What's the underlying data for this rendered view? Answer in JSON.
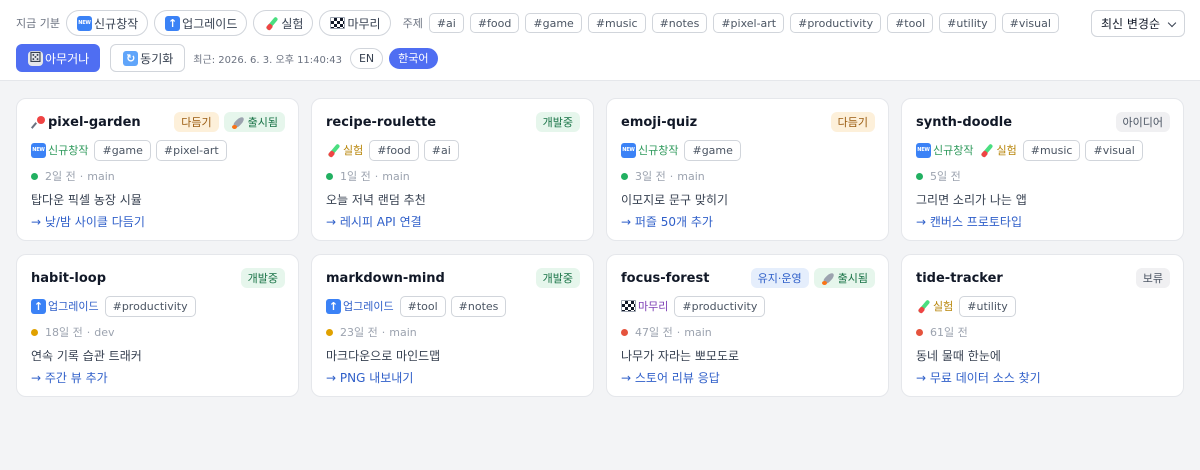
{
  "filter": {
    "current_label": "지금 기분",
    "moods": [
      {
        "icon": "new-icon",
        "label": "신규창작"
      },
      {
        "icon": "up-arrow-icon",
        "label": "업그레이드"
      },
      {
        "icon": "test-tube-icon",
        "label": "실험"
      },
      {
        "icon": "checkered-flag-icon",
        "label": "마무리"
      }
    ],
    "topic_label": "주제",
    "topics": [
      "#ai",
      "#food",
      "#game",
      "#music",
      "#notes",
      "#pixel-art",
      "#productivity",
      "#tool",
      "#utility",
      "#visual"
    ],
    "sort_value": "최신 변경순"
  },
  "actions": {
    "random_label": "아무거나",
    "sync_label": "동기화",
    "recent_text": "최근: 2026. 6. 3. 오후 11:40:43",
    "lang_en": "EN",
    "lang_ko": "한국어"
  },
  "projects": [
    {
      "name": "pixel-garden",
      "pinned": true,
      "badges": [
        {
          "kind": "polish",
          "label": "다듬기"
        },
        {
          "kind": "shipped",
          "label": "출시됨"
        }
      ],
      "category": {
        "kind": "new",
        "label": "신규창작"
      },
      "tags": [
        "#game",
        "#pixel-art"
      ],
      "status": "green",
      "age": "2일 전",
      "branch": "main",
      "description": "탑다운 픽셀 농장 시뮬",
      "next": "→ 낮/밤 사이클 다듬기"
    },
    {
      "name": "recipe-roulette",
      "pinned": false,
      "badges": [
        {
          "kind": "dev",
          "label": "개발중"
        }
      ],
      "category": {
        "kind": "test",
        "label": "실험"
      },
      "tags": [
        "#food",
        "#ai"
      ],
      "status": "green",
      "age": "1일 전",
      "branch": "main",
      "description": "오늘 저녁 랜덤 추천",
      "next": "→ 레시피 API 연결"
    },
    {
      "name": "emoji-quiz",
      "pinned": false,
      "badges": [
        {
          "kind": "polish",
          "label": "다듬기"
        }
      ],
      "category": {
        "kind": "new",
        "label": "신규창작"
      },
      "tags": [
        "#game"
      ],
      "status": "green",
      "age": "3일 전",
      "branch": "main",
      "description": "이모지로 문구 맞히기",
      "next": "→ 퍼즐 50개 추가"
    },
    {
      "name": "synth-doodle",
      "pinned": false,
      "badges": [
        {
          "kind": "idea",
          "label": "아이디어"
        }
      ],
      "category": {
        "kind": "new",
        "label": "신규창작"
      },
      "category2": {
        "kind": "test",
        "label": "실험"
      },
      "tags": [
        "#music",
        "#visual"
      ],
      "status": "green",
      "age": "5일 전",
      "branch": "",
      "description": "그리면 소리가 나는 앱",
      "next": "→ 캔버스 프로토타입"
    },
    {
      "name": "habit-loop",
      "pinned": false,
      "badges": [
        {
          "kind": "dev",
          "label": "개발중"
        }
      ],
      "category": {
        "kind": "up",
        "label": "업그레이드"
      },
      "tags": [
        "#productivity"
      ],
      "status": "yellow",
      "age": "18일 전",
      "branch": "dev",
      "description": "연속 기록 습관 트래커",
      "next": "→ 주간 뷰 추가"
    },
    {
      "name": "markdown-mind",
      "pinned": false,
      "badges": [
        {
          "kind": "dev",
          "label": "개발중"
        }
      ],
      "category": {
        "kind": "up",
        "label": "업그레이드"
      },
      "tags": [
        "#tool",
        "#notes"
      ],
      "status": "yellow",
      "age": "23일 전",
      "branch": "main",
      "description": "마크다운으로 마인드맵",
      "next": "→ PNG 내보내기"
    },
    {
      "name": "focus-forest",
      "pinned": false,
      "badges": [
        {
          "kind": "maint",
          "label": "유지·운영"
        },
        {
          "kind": "shipped",
          "label": "출시됨"
        }
      ],
      "category": {
        "kind": "flag",
        "label": "마무리"
      },
      "tags": [
        "#productivity"
      ],
      "status": "red",
      "age": "47일 전",
      "branch": "main",
      "description": "나무가 자라는 뽀모도로",
      "next": "→ 스토어 리뷰 응답"
    },
    {
      "name": "tide-tracker",
      "pinned": false,
      "badges": [
        {
          "kind": "hold",
          "label": "보류"
        }
      ],
      "category": {
        "kind": "test",
        "label": "실험"
      },
      "tags": [
        "#utility"
      ],
      "status": "red",
      "age": "61일 전",
      "branch": "",
      "description": "동네 물때 한눈에",
      "next": "→ 무료 데이터 소스 찾기"
    }
  ]
}
